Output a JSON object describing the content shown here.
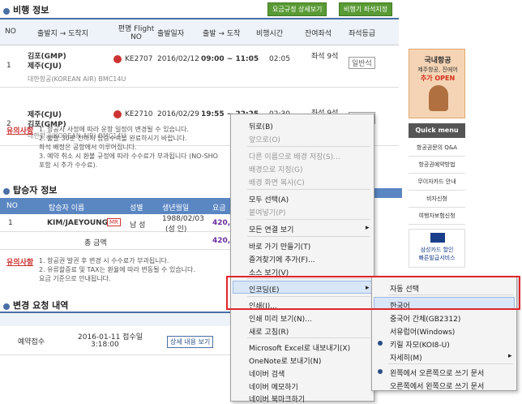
{
  "flight": {
    "title": "비행 정보",
    "btn1": "요금규정 상세보기",
    "btn2": "비행기 좌석지정",
    "headers": [
      "NO",
      "출발지 → 도착지",
      "편명 Flight NO",
      "출발일자",
      "출발 → 도착",
      "비행시간",
      "잔여좌석",
      "좌석등급"
    ],
    "rows": [
      {
        "no": "1",
        "route1": "김포(GMP)",
        "route2": "제주(CJU)",
        "flight": "KE2707",
        "date": "2016/02/12",
        "time": "09:00 ~ 11:05",
        "dur": "02:05",
        "seat1": "좌석 9석",
        "seat2": "",
        "cls": "일반석",
        "sub": "대한항공(KOREAN AIR) BMC14U"
      },
      {
        "no": "2",
        "route1": "제주(CJU)",
        "route2": "김포(GMP)",
        "flight": "KE2710",
        "date": "2016/02/29",
        "time": "19:55 ~ 22:25",
        "dur": "02:30",
        "seat1": "좌석 9석",
        "seat2": "",
        "cls": "일반석",
        "sub": "대한항공(KOREAN AIR) BMC14U"
      }
    ],
    "notice_label": "유의사항",
    "notice_lines": [
      "1. 항공사 사정에 따라 운항 일정이 변경될 수 있습니다.",
      "2. 출발 30분 전까지 탑승수속을 완료하시기 바랍니다.",
      "좌석 배정은 공항에서 이루어집니다.",
      "3. 예약 취소 시 환불 규정에 따라 수수료가 부과됩니다 (NO-SHO",
      "포함 시 추가 수수료)."
    ]
  },
  "passenger": {
    "title": "탑승자 정보",
    "headers": [
      "NO",
      "탑승자 이름",
      "성별",
      "생년월일",
      "요금"
    ],
    "row": {
      "no": "1",
      "name": "KIM/JAEYOUNG",
      "tag": "MR",
      "gender": "남 성",
      "dob": "1988/02/03",
      "dob2": "(성 인)",
      "fare": "420,0"
    },
    "total_label": "총 금액",
    "total": "420,0",
    "notice_label": "유의사항",
    "notice_lines": [
      "1. 항공권 발권 후 변경 시 수수료가 부과됩니다.",
      "2. 유류할증료 및 TAX는 환율에 따라 변동될 수 있습니다.",
      "요금 기준으로 안내됩니다."
    ]
  },
  "change": {
    "title": "변경 요청 내역",
    "left": "예약접수",
    "date": "2016-01-11 접수일",
    "time": "3:18:00",
    "btn": "상세 내용 보기"
  },
  "side": {
    "banner_l1": "국내항공",
    "banner_l2": "제주항공, 진에어",
    "banner_l3": "추가 OPEN",
    "quick": "Quick menu",
    "items": [
      "항공권문의 Q&A",
      "항공권예약방법",
      "무이자카드 안내",
      "비자신청",
      "여행자보험신청"
    ],
    "card1": "삼성카드 할인",
    "card2": "빠른발급서비스"
  },
  "context_menu": {
    "items": [
      {
        "label": "뒤로(B)",
        "dis": false
      },
      {
        "label": "앞으로(O)",
        "dis": true
      },
      {
        "label": "다른 이름으로 배경 저장(S)...",
        "dis": true
      },
      {
        "label": "배경으로 지정(G)",
        "dis": true
      },
      {
        "label": "배경 화면 복사(C)",
        "dis": true
      },
      {
        "label": "모두 선택(A)",
        "dis": false
      },
      {
        "label": "붙여넣기(P)",
        "dis": true
      },
      {
        "label": "모든 연결 보기",
        "dis": false
      },
      {
        "label": "바로 가기 만들기(T)",
        "dis": false
      },
      {
        "label": "즐겨찾기에 추가(F)...",
        "dis": false
      },
      {
        "label": "소스 보기(V)",
        "dis": false
      },
      {
        "label": "인코딩(E)",
        "dis": false
      },
      {
        "label": "인쇄(I)...",
        "dis": false
      },
      {
        "label": "인쇄 미리 보기(N)...",
        "dis": false
      },
      {
        "label": "새로 고침(R)",
        "dis": false
      },
      {
        "label": "Microsoft Excel로 내보내기(X)",
        "dis": false
      },
      {
        "label": "OneNote로 보내기(N)",
        "dis": false
      },
      {
        "label": "네이버 검색",
        "dis": false
      },
      {
        "label": "네이버 메모하기",
        "dis": false
      },
      {
        "label": "네이버 북마크하기",
        "dis": false
      }
    ]
  },
  "submenu": {
    "items": [
      "자동 선택",
      "한국어",
      "중국어 간체(GB2312)",
      "서유럽어(Windows)",
      "키릴 자모(KOI8-U)",
      "자세히(M)",
      "왼쪽에서 오른쪽으로 쓰기 문서",
      "오른쪽에서 왼쪽으로 쓰기 문서"
    ]
  },
  "colors": {
    "highlight": "#e0262a",
    "green": "#5a9a35",
    "blue": "#5a86c2"
  }
}
